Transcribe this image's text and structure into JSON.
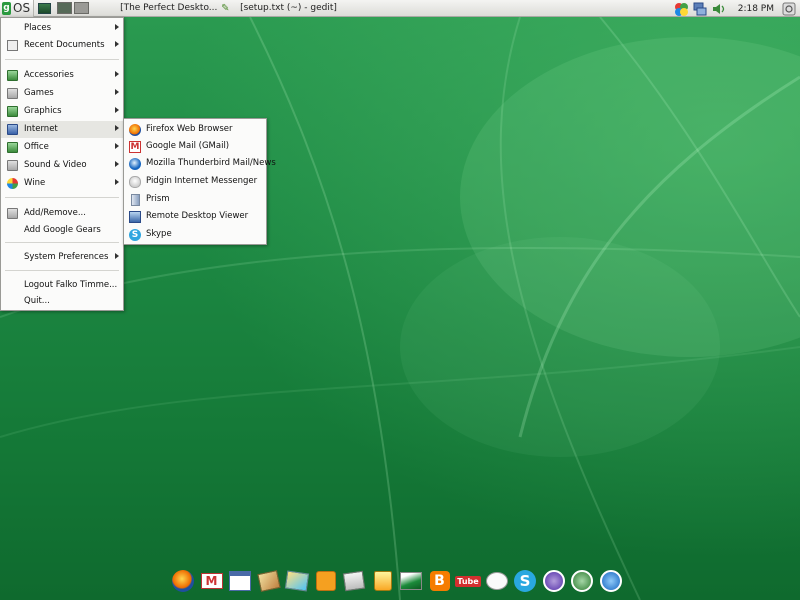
{
  "panel": {
    "os_label": "OS",
    "os_logo_glyph": "g",
    "tasks": [
      {
        "label": "[The Perfect Deskto...",
        "icon": "firefox-icon"
      },
      {
        "label": "[setup.txt (~) - gedit]",
        "icon": "gedit-icon",
        "icon_glyph": "✎"
      }
    ],
    "clock": "2:18 PM"
  },
  "menu": {
    "items": [
      {
        "label": "Places"
      },
      {
        "label": "Recent Documents"
      },
      {
        "label": "Accessories"
      },
      {
        "label": "Games"
      },
      {
        "label": "Graphics"
      },
      {
        "label": "Internet"
      },
      {
        "label": "Office"
      },
      {
        "label": "Sound & Video"
      },
      {
        "label": "Wine"
      },
      {
        "label": "Add/Remove..."
      },
      {
        "label": "Add Google Gears"
      },
      {
        "label": "System Preferences"
      },
      {
        "label": "Logout Falko Timme..."
      },
      {
        "label": "Quit..."
      }
    ]
  },
  "submenu": {
    "items": [
      {
        "label": "Firefox Web Browser"
      },
      {
        "label": "Google Mail (GMail)",
        "icon_glyph": "M"
      },
      {
        "label": "Mozilla Thunderbird Mail/News"
      },
      {
        "label": "Pidgin Internet Messenger"
      },
      {
        "label": "Prism"
      },
      {
        "label": "Remote Desktop Viewer"
      },
      {
        "label": "Skype",
        "icon_glyph": "S"
      }
    ]
  },
  "dock": {
    "items": [
      "firefox",
      "gmail",
      "calendar",
      "photos",
      "maps",
      "rss",
      "news",
      "shopping",
      "picasa",
      "blogger",
      "youtube",
      "chat",
      "skype",
      "openoffice-1",
      "openoffice-2",
      "openoffice-3"
    ],
    "gmail_glyph": "M",
    "blogger_glyph": "B",
    "youtube_label": "Tube",
    "skype_glyph": "S"
  },
  "colors": {
    "desktop": "#1a7a3a",
    "menu_bg": "#fbfbfa",
    "active_item": "#e6e6e2"
  }
}
